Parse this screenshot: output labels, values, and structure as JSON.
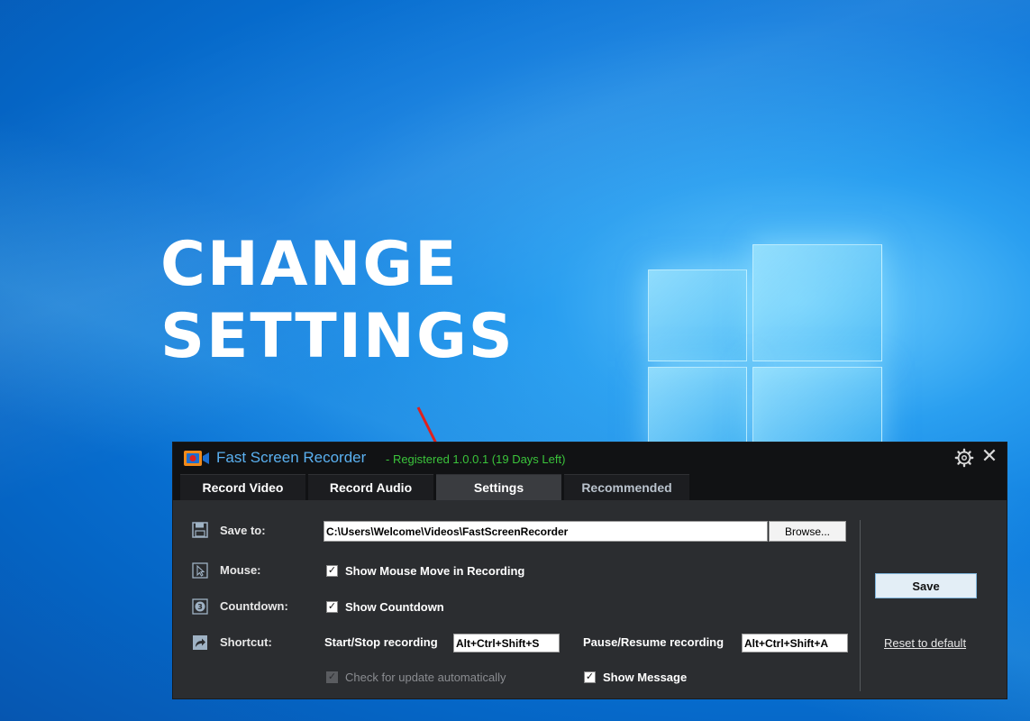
{
  "background": {
    "headline_line1": "CHANGE",
    "headline_line2": "SETTINGS",
    "accent": "#0a78dc"
  },
  "app": {
    "title": "Fast Screen Recorder",
    "registration": "- Registered 1.0.0.1 (19 Days Left)",
    "icons": {
      "logo": "camera-logo-icon",
      "settings": "gear-icon",
      "close": "close-icon"
    },
    "close_glyph": "✕",
    "tabs": [
      {
        "label": "Record Video",
        "active": false
      },
      {
        "label": "Record Audio",
        "active": false
      },
      {
        "label": "Settings",
        "active": true
      },
      {
        "label": "Recommended",
        "active": false
      }
    ],
    "settings": {
      "save_to": {
        "label": "Save to:",
        "value": "C:\\Users\\Welcome\\Videos\\FastScreenRecorder",
        "browse_label": "Browse..."
      },
      "mouse": {
        "label": "Mouse:",
        "checkbox_label": "Show Mouse Move in Recording",
        "checked": true
      },
      "countdown": {
        "label": "Countdown:",
        "checkbox_label": "Show Countdown",
        "checked": true
      },
      "shortcut": {
        "label": "Shortcut:",
        "start_stop_label": "Start/Stop recording",
        "start_stop_value": "Alt+Ctrl+Shift+S",
        "pause_resume_label": "Pause/Resume recording",
        "pause_resume_value": "Alt+Ctrl+Shift+A"
      },
      "update": {
        "checkbox_label": "Check for update automatically",
        "checked": true,
        "disabled": true
      },
      "message": {
        "checkbox_label": "Show Message",
        "checked": true
      }
    },
    "save_label": "Save",
    "reset_label": "Reset to default",
    "colors": {
      "title": "#5ab0f0",
      "registered": "#3bc43b",
      "arrow": "#e0201c"
    }
  }
}
